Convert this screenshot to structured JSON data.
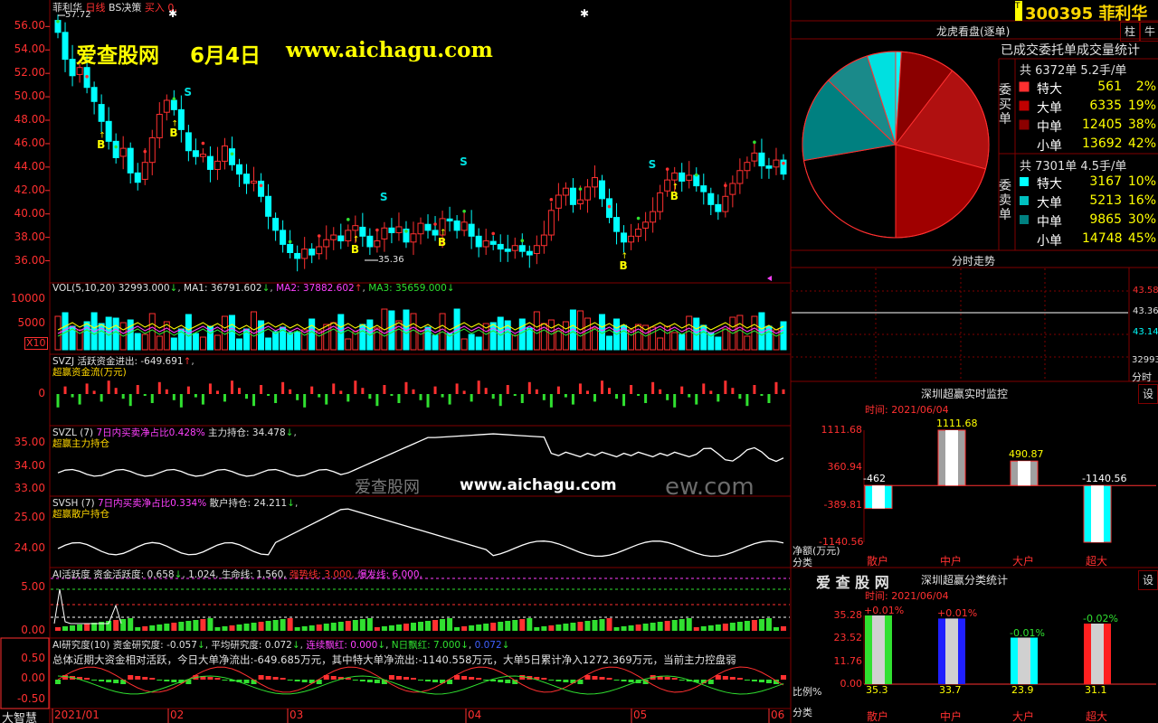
{
  "stock": {
    "code": "300395",
    "name": "菲利华",
    "tag": "T"
  },
  "header": {
    "stock_short": "菲利华",
    "period": "日线",
    "strategy": "BS决策",
    "buy_label": "买入",
    "buy_value": "0,",
    "high_mark": "57.72",
    "low_mark": "35.36"
  },
  "watermark": {
    "brand": "爱查股网",
    "date": "6月4日",
    "url": "www.aichagu.com",
    "url2": "www.aichagu.com",
    "brand2": "爱查股网",
    "tail": "ew.com"
  },
  "vol_line": {
    "label": "VOL(5,10,20)",
    "vol": "32993.000",
    "ma1": "MA1: 36791.602",
    "ma2": "MA2: 37882.602",
    "ma3": "MA3: 35659.000",
    "mult": "X10"
  },
  "svzj": {
    "name": "SVZJ",
    "text": "活跃资金进出: -649.691",
    "sub": "超赢资金流(万元)"
  },
  "svzl": {
    "name": "SVZL (7)",
    "text": "7日内买卖净占比0.428%",
    "hold": "主力持仓: 34.478",
    "sub": "超赢主力持仓"
  },
  "svsh": {
    "name": "SVSH (7)",
    "text": "7日内买卖净占比0.334%",
    "hold": "散户持仓: 24.211",
    "sub": "超赢散户持仓"
  },
  "ai_active": {
    "name": "AI活跃度",
    "fund": "资金活跃度: 0.658",
    "v2": "1.024",
    "life": "生命线: 1.560,",
    "strong": "强势线: 3.000,",
    "burst": "爆发线: 6.000,"
  },
  "ai_research": {
    "name": "AI研究度(10)",
    "fund": "资金研究度: -0.057",
    "avg": "平均研究度: 0.072",
    "lh": "连续飘红: 0.000",
    "nr": "N日飘红: 7.000",
    "last": "0.072",
    "summary": "总体近期大资金相对活跃，今日大单净流出:-649.685万元，其中特大单净流出:-1140.558万元，大单5日累计净入1272.369万元，当前主力控盘弱"
  },
  "xaxis": {
    "labels": [
      "2021/01",
      "02",
      "03",
      "04",
      "05",
      "06"
    ],
    "corner": "大智慧"
  },
  "y_main": [
    "56.00",
    "54.00",
    "52.00",
    "50.00",
    "48.00",
    "46.00",
    "44.00",
    "42.00",
    "40.00",
    "38.00",
    "36.00"
  ],
  "y_vol": [
    "10000",
    "5000"
  ],
  "y_svzj": [
    "0"
  ],
  "y_svzl": [
    "35.00",
    "34.00",
    "33.00"
  ],
  "y_svsh": [
    "25.00",
    "24.00"
  ],
  "y_ai": [
    "5.00",
    "0.00"
  ],
  "y_res": [
    "0.50",
    "0.00",
    "-0.50"
  ],
  "signals": {
    "buy": "B",
    "sell": "S"
  },
  "right": {
    "dragon_title": "龙虎看盘(逐单)",
    "done_title": "已成交委托单成交量统计",
    "buy_side": "委买单",
    "sell_side": "委卖单",
    "buy_total": "共 6372单 5.2手/单",
    "sell_total": "共 7301单 4.5手/单",
    "buy_rows": [
      {
        "label": "特大",
        "count": "561",
        "pct": "2%"
      },
      {
        "label": "大单",
        "count": "6335",
        "pct": "19%"
      },
      {
        "label": "中单",
        "count": "12405",
        "pct": "38%"
      },
      {
        "label": "小单",
        "count": "13692",
        "pct": "42%"
      }
    ],
    "sell_rows": [
      {
        "label": "特大",
        "count": "3167",
        "pct": "10%"
      },
      {
        "label": "大单",
        "count": "5213",
        "pct": "16%"
      },
      {
        "label": "中单",
        "count": "9865",
        "pct": "30%"
      },
      {
        "label": "小单",
        "count": "14748",
        "pct": "45%"
      }
    ],
    "timeshare_title": "分时走势",
    "ts_prices": [
      "43.58",
      "43.36",
      "43.14"
    ],
    "ts_vol": "32993",
    "ts_corner": "分时",
    "monitor_title": "深圳超赢实时监控",
    "monitor_time": "时间: 2021/06/04",
    "monitor_btn": "设",
    "monitor_y": [
      "1111.68",
      "360.94",
      "-389.81",
      "-1140.56"
    ],
    "monitor_unit": "净额(万元)",
    "monitor_cat": "分类",
    "stat_title": "深圳超赢分类统计",
    "stat_brand": "爱 查 股 网",
    "stat_time": "时间: 2021/06/04",
    "stat_btn": "设",
    "stat_y": [
      "35.28",
      "23.52",
      "11.76",
      "0.00"
    ],
    "stat_unit": "比例%",
    "stat_cat": "分类",
    "cats": [
      "散户",
      "中户",
      "大户",
      "超大"
    ],
    "stock_tab": "柱",
    "stock_tab2": "牛"
  },
  "colors": {
    "up": "#ff3030",
    "down": "#00ffff",
    "border": "#800000",
    "text_gold": "#ffd700"
  },
  "chart_data": [
    {
      "type": "candlestick",
      "title": "菲利华 日线",
      "ylim": [
        34.5,
        57.8
      ],
      "period": "2021/01 - 2021/06",
      "x": [
        "01",
        "02",
        "03",
        "04",
        "05",
        "06"
      ],
      "marks": {
        "high": 57.72,
        "low": 35.36
      },
      "series": [
        {
          "name": "close",
          "values": [
            55.5,
            53.2,
            51.8,
            52.5,
            50.8,
            49.6,
            47.9,
            46.2,
            44.8,
            45.6,
            43.5,
            42.7,
            44.4,
            46.5,
            48.5,
            49.7,
            48.9,
            47.2,
            45.4,
            44.9,
            45.1,
            43.8,
            44.5,
            45.8,
            44.2,
            43.4,
            42.6,
            42.8,
            41.5,
            39.8,
            38.6,
            37.4,
            36.7,
            36.2,
            37.0,
            36.5,
            37.2,
            37.8,
            38.2,
            37.7,
            38.6,
            39.0,
            38.1,
            37.2,
            37.7,
            38.8,
            38.4,
            38.9,
            37.6,
            38.3,
            39.2,
            38.6,
            38.2,
            39.6,
            39.4,
            38.6,
            39.3,
            38.1,
            37.2,
            37.7,
            37.4,
            37.0,
            36.8,
            37.3,
            36.8,
            36.5,
            37.3,
            38.2,
            40.3,
            41.6,
            42.2,
            40.8,
            41.2,
            42.3,
            43.1,
            41.3,
            39.7,
            38.5,
            37.6,
            38.1,
            38.7,
            39.3,
            40.2,
            41.8,
            42.9,
            43.5,
            42.8,
            43.3,
            42.4,
            41.9,
            40.8,
            40.2,
            41.5,
            42.6,
            43.7,
            44.4,
            45.2,
            44.1,
            43.9,
            44.6,
            43.4
          ]
        }
      ]
    },
    {
      "type": "bar",
      "title": "VOL(5,10,20)",
      "series": [
        {
          "name": "MA1",
          "values": [
            36791.602
          ]
        },
        {
          "name": "MA2",
          "values": [
            37882.602
          ]
        },
        {
          "name": "MA3",
          "values": [
            35659.0
          ]
        }
      ],
      "last": 32993
    },
    {
      "type": "line",
      "title": "SVZL",
      "ylim": [
        32.8,
        35.6
      ],
      "last": 34.478
    },
    {
      "type": "line",
      "title": "SVSH",
      "ylim": [
        23.5,
        25.6
      ],
      "last": 24.211
    },
    {
      "type": "pie",
      "title": "龙虎看盘(逐单)",
      "categories": [
        "委买特大",
        "委买大单",
        "委买中单",
        "委买小单",
        "委卖小单",
        "委卖中单",
        "委卖大单",
        "委卖特大"
      ],
      "values": [
        1,
        9.5,
        19,
        21,
        22.5,
        15,
        8,
        5
      ]
    },
    {
      "type": "bar",
      "title": "深圳超赢实时监控",
      "categories": [
        "散户",
        "中户",
        "大户",
        "超大"
      ],
      "values": [
        -462,
        1111.68,
        490.87,
        -1140.56
      ],
      "ylim": [
        -1140.56,
        1111.68
      ]
    },
    {
      "type": "bar",
      "title": "深圳超赢分类统计",
      "categories": [
        "散户",
        "中户",
        "大户",
        "超大"
      ],
      "values": [
        35.3,
        33.7,
        23.9,
        31.1
      ],
      "changes": [
        "+0.01%",
        "+0.01%",
        "-0.01%",
        "-0.02%"
      ],
      "ylim": [
        0,
        35.28
      ]
    }
  ]
}
